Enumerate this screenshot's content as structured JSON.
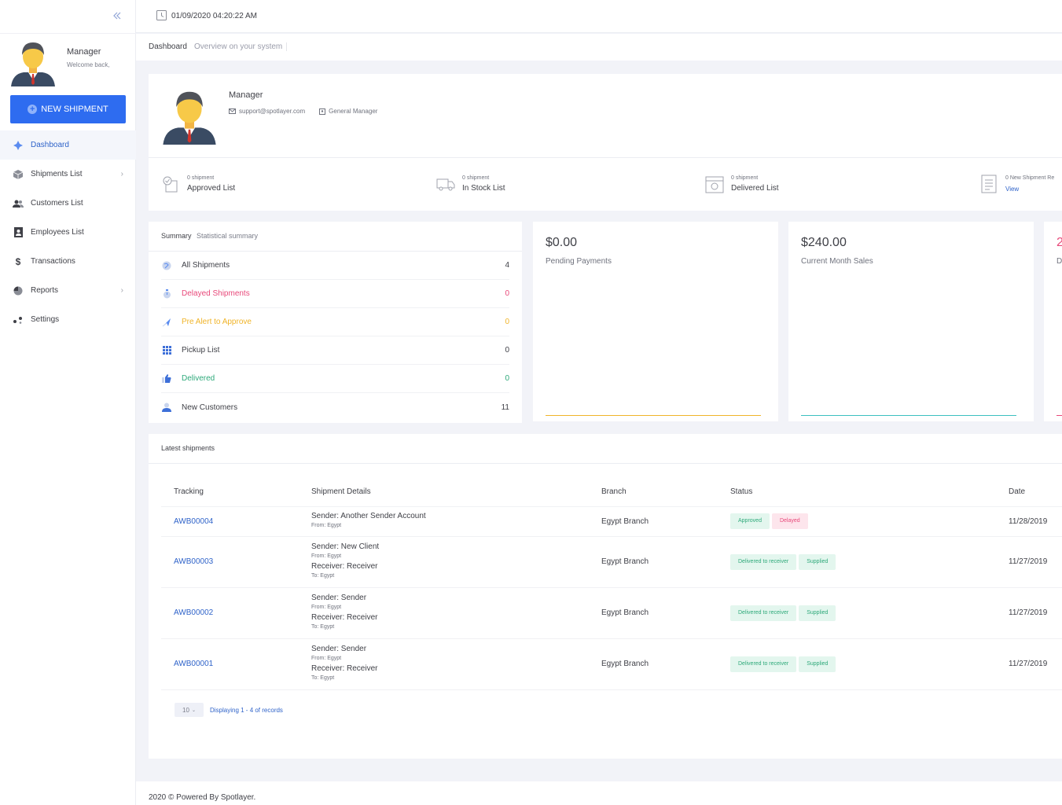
{
  "header": {
    "datetime": "01/09/2020 04:20:22 AM"
  },
  "subheader": {
    "crumb": "Dashboard",
    "description": "Overview on your system"
  },
  "sidebar": {
    "user_name": "Manager",
    "welcome": "Welcome back,",
    "new_shipment_label": "NEW SHIPMENT",
    "items": [
      {
        "label": "Dashboard",
        "icon": "dashboard-icon",
        "active": true,
        "chevron": false
      },
      {
        "label": "Shipments List",
        "icon": "box-icon",
        "chevron": true
      },
      {
        "label": "Customers List",
        "icon": "users-icon",
        "chevron": false
      },
      {
        "label": "Employees List",
        "icon": "id-card-icon",
        "chevron": false
      },
      {
        "label": "Transactions",
        "icon": "dollar-icon",
        "chevron": false
      },
      {
        "label": "Reports",
        "icon": "pie-chart-icon",
        "chevron": true
      },
      {
        "label": "Settings",
        "icon": "settings-icon",
        "chevron": false
      }
    ]
  },
  "profile": {
    "name": "Manager",
    "email": "support@spotlayer.com",
    "role": "General Manager",
    "stats": [
      {
        "count": "0 shipment",
        "label": "Approved List",
        "icon": "approved-icon"
      },
      {
        "count": "0 shipment",
        "label": "In Stock List",
        "icon": "truck-icon"
      },
      {
        "count": "0 shipment",
        "label": "Delivered List",
        "icon": "delivered-icon"
      },
      {
        "count": "0 New Shipment Re",
        "link": "View",
        "icon": "document-icon"
      }
    ]
  },
  "summary": {
    "title": "Summary",
    "description": "Statistical summary",
    "rows": [
      {
        "label": "All Shipments",
        "value": "4",
        "color": "#3f4047",
        "icon": "globe-icon"
      },
      {
        "label": "Delayed Shipments",
        "value": "0",
        "color": "#e8497a",
        "icon": "timer-icon"
      },
      {
        "label": "Pre Alert to Approve",
        "value": "0",
        "color": "#f0b429",
        "icon": "plane-icon"
      },
      {
        "label": "Pickup List",
        "value": "0",
        "color": "#3f4047",
        "icon": "grid-icon"
      },
      {
        "label": "Delivered",
        "value": "0",
        "color": "#2ea97a",
        "icon": "thumbs-up-icon"
      },
      {
        "label": "New Customers",
        "value": "11",
        "color": "#3f4047",
        "icon": "user-icon"
      }
    ]
  },
  "metrics": [
    {
      "amount": "$0.00",
      "label": "Pending Payments",
      "line_color": "#f0b429"
    },
    {
      "amount": "$240.00",
      "label": "Current Month Sales",
      "line_color": "#3cc0c0"
    },
    {
      "amount": "2",
      "label": "D",
      "line_color": "#e8497a"
    }
  ],
  "latest": {
    "title": "Latest shipments",
    "columns": [
      "Tracking",
      "Shipment Details",
      "Branch",
      "Status",
      "Date"
    ],
    "rows": [
      {
        "tracking": "AWB00004",
        "sender": "Sender: Another Sender Account",
        "from": "From: Egypt",
        "receiver": "",
        "to": "",
        "branch": "Egypt Branch",
        "badges": [
          {
            "text": "Approved",
            "tone": "green"
          },
          {
            "text": "Delayed",
            "tone": "red"
          }
        ],
        "date": "11/28/2019"
      },
      {
        "tracking": "AWB00003",
        "sender": "Sender: New Client",
        "from": "From: Egypt",
        "receiver": "Receiver: Receiver",
        "to": "To: Egypt",
        "branch": "Egypt Branch",
        "badges": [
          {
            "text": "Delivered to receiver",
            "tone": "green"
          },
          {
            "text": "Supplied",
            "tone": "green"
          }
        ],
        "date": "11/27/2019"
      },
      {
        "tracking": "AWB00002",
        "sender": "Sender: Sender",
        "from": "From: Egypt",
        "receiver": "Receiver: Receiver",
        "to": "To: Egypt",
        "branch": "Egypt Branch",
        "badges": [
          {
            "text": "Delivered to receiver",
            "tone": "green"
          },
          {
            "text": "Supplied",
            "tone": "green"
          }
        ],
        "date": "11/27/2019"
      },
      {
        "tracking": "AWB00001",
        "sender": "Sender: Sender",
        "from": "From: Egypt",
        "receiver": "Receiver: Receiver",
        "to": "To: Egypt",
        "branch": "Egypt Branch",
        "badges": [
          {
            "text": "Delivered to receiver",
            "tone": "green"
          },
          {
            "text": "Supplied",
            "tone": "green"
          }
        ],
        "date": "11/27/2019"
      }
    ],
    "page_size": "10",
    "displaying": "Displaying 1 - 4 of records"
  },
  "footer": {
    "text": "2020 © Powered By Spotlayer."
  }
}
